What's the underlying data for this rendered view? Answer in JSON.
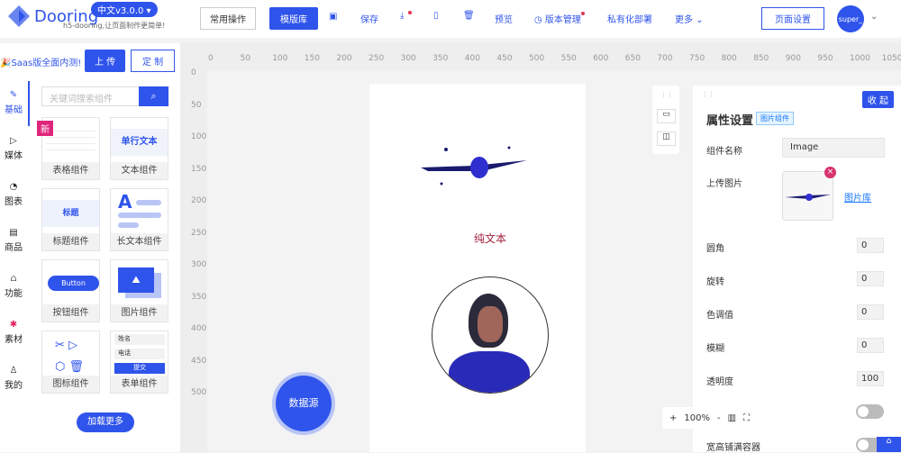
{
  "header": {
    "logo": "Dooring",
    "version": "中文v3.0.0 ▾",
    "slogan": "h5-dooring,让页面制作更简单!",
    "common_ops": "常用操作",
    "template_lib": "模版库",
    "save": "保存",
    "preview": "预览",
    "version_mgmt": "版本管理",
    "private_deploy": "私有化部署",
    "more": "更多",
    "page_settings": "页面设置",
    "user": "super_"
  },
  "left": {
    "saas_notice": "Saas版全面内测!",
    "upload": "上 传",
    "custom": "定 制",
    "search_placeholder": "关键词搜索组件",
    "new_badge": "新",
    "load_more": "加载更多",
    "categories": [
      "基础",
      "媒体",
      "图表",
      "商品",
      "功能",
      "素材",
      "我的"
    ],
    "components": [
      "表格组件",
      "文本组件",
      "标题组件",
      "长文本组件",
      "按钮组件",
      "图片组件",
      "图标组件",
      "表单组件"
    ],
    "preview_text": {
      "single_line": "单行文本",
      "title": "标题",
      "button": "Button",
      "name": "姓名",
      "phone": "电话",
      "submit": "提交"
    }
  },
  "ruler": {
    "h": [
      "0",
      "50",
      "100",
      "150",
      "200",
      "250",
      "300",
      "350",
      "400",
      "450",
      "500",
      "550",
      "600",
      "650",
      "700",
      "750",
      "800",
      "850",
      "900",
      "950",
      "1000",
      "1050"
    ],
    "v": [
      "0",
      "50",
      "100",
      "150",
      "200",
      "250",
      "300",
      "350",
      "400",
      "450",
      "500"
    ]
  },
  "canvas": {
    "text": "纯文本",
    "datasource": "数据源",
    "zoom": "100%",
    "zoom_in": "+",
    "zoom_out": "-"
  },
  "props": {
    "collapse": "收 起",
    "title": "属性设置",
    "tag": "图片组件",
    "name_label": "组件名称",
    "name_value": "Image",
    "upload_label": "上传图片",
    "gallery": "图片库",
    "fields": [
      {
        "label": "圆角",
        "value": "0"
      },
      {
        "label": "旋转",
        "value": "0"
      },
      {
        "label": "色调值",
        "value": "0"
      },
      {
        "label": "模糊",
        "value": "0"
      },
      {
        "label": "透明度",
        "value": "100"
      }
    ],
    "fill_label": "宽高铺满容器"
  }
}
